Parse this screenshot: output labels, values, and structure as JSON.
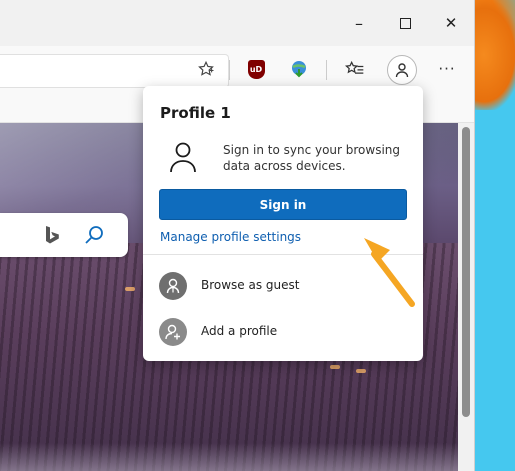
{
  "window": {
    "controls": {
      "minimize": "–",
      "maximize": "□",
      "close": "✕"
    }
  },
  "toolbar": {
    "favorite_icon": "star-outline-icon",
    "ublock_badge": "uD",
    "more_label": "···"
  },
  "profile_flyout": {
    "title": "Profile 1",
    "description": "Sign in to sync your browsing data across devices.",
    "sign_in_label": "Sign in",
    "manage_link": "Manage profile settings",
    "items": [
      {
        "label": "Browse as guest",
        "icon": "guest-icon"
      },
      {
        "label": "Add a profile",
        "icon": "add-profile-icon"
      }
    ]
  },
  "colors": {
    "sign_in_button": "#0f6cbd",
    "link": "#0f5fb0",
    "annotation_arrow": "#f5a623",
    "desktop": "#45c8ef"
  }
}
